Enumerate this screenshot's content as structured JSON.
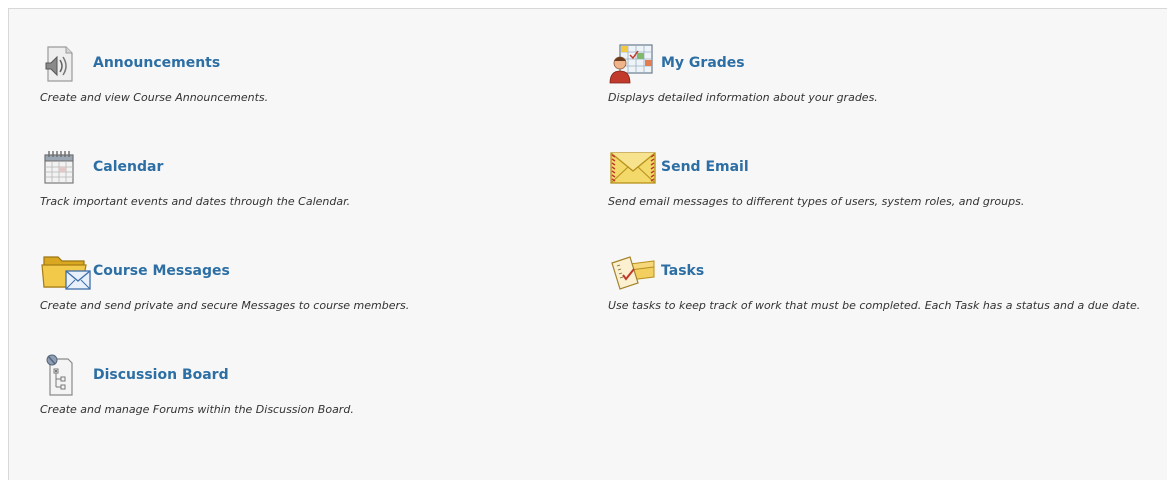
{
  "colors": {
    "link": "#2d6fa4",
    "description": "#333333",
    "panel_background": "#f7f7f7"
  },
  "tools": {
    "announcements": {
      "title": "Announcements",
      "description": "Create and view Course Announcements.",
      "icon": "speaker-icon"
    },
    "calendar": {
      "title": "Calendar",
      "description": "Track important events and dates through the Calendar.",
      "icon": "calendar-icon"
    },
    "course_messages": {
      "title": "Course Messages",
      "description": "Create and send private and secure Messages to course members.",
      "icon": "folder-envelope-icon"
    },
    "discussion_board": {
      "title": "Discussion Board",
      "description": "Create and manage Forums within the Discussion Board.",
      "icon": "discussion-board-icon"
    },
    "my_grades": {
      "title": "My Grades",
      "description": "Displays detailed information about your grades.",
      "icon": "grades-icon"
    },
    "send_email": {
      "title": "Send Email",
      "description": "Send email messages to different types of users, system roles, and groups.",
      "icon": "envelope-icon"
    },
    "tasks": {
      "title": "Tasks",
      "description": "Use tasks to keep track of work that must be completed. Each Task has a status and a due date.",
      "icon": "tasks-icon"
    }
  }
}
